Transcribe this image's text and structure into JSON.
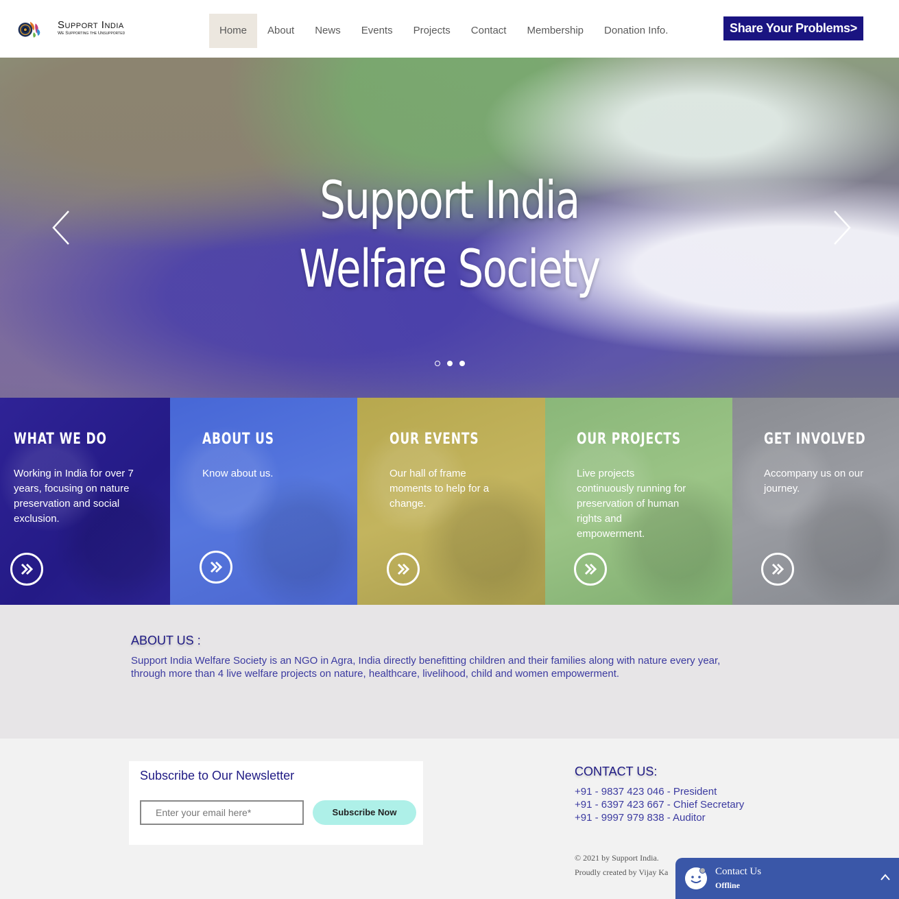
{
  "header": {
    "logo_title": "Support India",
    "logo_subtitle": "We Supporting the Unsupported",
    "nav": [
      {
        "label": "Home",
        "active": true
      },
      {
        "label": "About"
      },
      {
        "label": "News"
      },
      {
        "label": "Events"
      },
      {
        "label": "Projects"
      },
      {
        "label": "Contact"
      },
      {
        "label": "Membership"
      },
      {
        "label": "Donation Info."
      }
    ],
    "cta_label": "Share Your Problems>"
  },
  "hero": {
    "title_line1": "Support India",
    "title_line2": "Welfare Society",
    "slides": 3,
    "active_slide": 1
  },
  "tiles": [
    {
      "title": "WHAT WE DO",
      "text": "Working in India for over 7 years, focusing on nature preservation and social exclusion."
    },
    {
      "title": "ABOUT US",
      "text": "Know about us."
    },
    {
      "title": "OUR EVENTS",
      "text": "Our hall of frame moments to help for a change."
    },
    {
      "title": "OUR PROJECTS",
      "text": "Live projects continuously running for preservation of human rights and empowerment."
    },
    {
      "title": "GET INVOLVED",
      "text": "Accompany us on our journey."
    }
  ],
  "about": {
    "heading": "ABOUT US :",
    "body": "Support India Welfare Society is an NGO in Agra, India directly benefitting children and their families along with nature every year, through more than 4 live welfare projects on nature, healthcare, livelihood, child and women empowerment."
  },
  "newsletter": {
    "heading": "Subscribe to Our Newsletter",
    "email_placeholder": "Enter your email here*",
    "button_label": "Subscribe Now"
  },
  "contact": {
    "heading": "CONTACT US:",
    "lines": [
      "+91 - 9837 423 046 - President",
      "+91 - 6397 423 667 - Chief Secretary",
      "+91 - 9997 979 838 - Auditor"
    ]
  },
  "copyright": {
    "line1": "© 2021 by Support India.",
    "line2": "Proudly created by Vijay Ka"
  },
  "chat": {
    "title": "Contact Us",
    "status": "Offline"
  },
  "colors": {
    "brand_navy": "#1a1481",
    "heading_blue": "#1f1a84",
    "subscribe_mint": "#aef0e8",
    "chat_blue": "#3a57a8"
  }
}
